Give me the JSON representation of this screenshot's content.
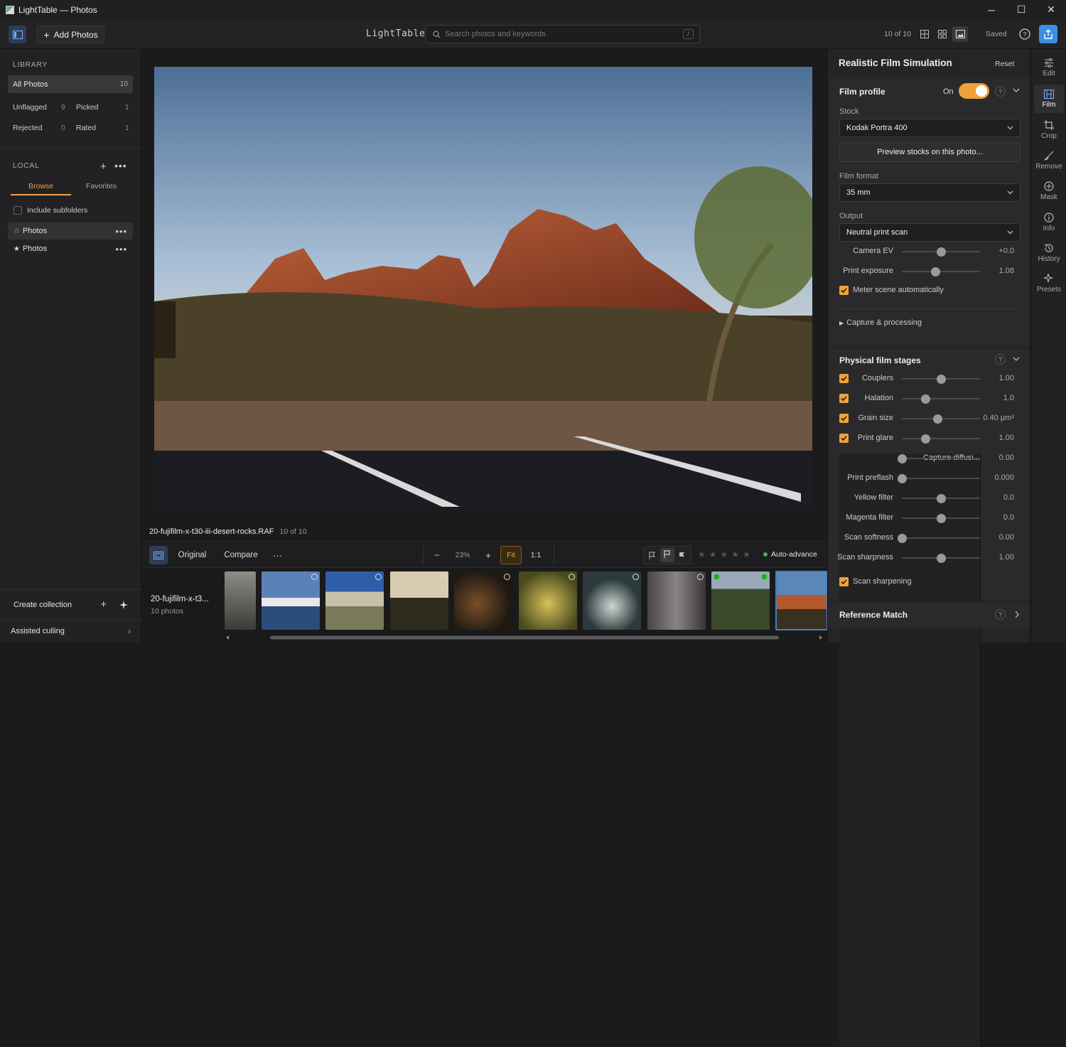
{
  "window": {
    "title": "LightTable — Photos",
    "minimize": "─",
    "maximize": "☐",
    "close": "✕"
  },
  "toolbar": {
    "add_photos": "Add Photos",
    "brand": "LightTable",
    "search_placeholder": "Search photos and keywords",
    "search_key": "/",
    "count": "10 of 10",
    "status": "Saved"
  },
  "sidebar": {
    "library_title": "LIBRARY",
    "all_photos": {
      "label": "All Photos",
      "count": "10"
    },
    "stats": [
      {
        "label": "Unflagged",
        "count": "9"
      },
      {
        "label": "Picked",
        "count": "1"
      },
      {
        "label": "Rejected",
        "count": "0"
      },
      {
        "label": "Rated",
        "count": "1"
      }
    ],
    "local_title": "LOCAL",
    "tabs": [
      "Browse",
      "Favorites"
    ],
    "include_subfolders": "Include subfolders",
    "folders": [
      {
        "star": "☆",
        "label": "Photos"
      },
      {
        "star": "★",
        "label": "Photos"
      }
    ],
    "create_collection": "Create collection",
    "assisted_culling": "Assisted culling"
  },
  "main": {
    "filename": "20-fujifilm-x-t30-iii-desert-rocks.RAF",
    "position": "10 of 10",
    "controls": {
      "original": "Original",
      "compare": "Compare",
      "more": "···",
      "zoom_out": "–",
      "zoom": "23%",
      "zoom_in": "+",
      "fit": "Fit",
      "one_to_one": "1:1",
      "auto_advance": "Auto-advance"
    },
    "album": {
      "name": "20-fujifilm-x-t3...",
      "count": "10 photos"
    }
  },
  "panel": {
    "title": "Realistic Film Simulation",
    "reset": "Reset",
    "film_profile": {
      "title": "Film profile",
      "on_label": "On",
      "enabled": true,
      "stock_label": "Stock",
      "stock": "Kodak Portra 400",
      "preview_btn": "Preview stocks on this photo...",
      "format_label": "Film format",
      "format": "35 mm",
      "output_label": "Output",
      "output": "Neutral print scan",
      "sliders": [
        {
          "label": "Camera EV",
          "value": "+0.0",
          "level": 0.5
        },
        {
          "label": "Print exposure",
          "value": "1.08",
          "level": 0.43
        }
      ],
      "meter": "Meter scene automatically",
      "capture": "Capture & processing"
    },
    "stages": {
      "title": "Physical film stages",
      "rows": [
        {
          "check": true,
          "label": "Couplers",
          "value": "1.00",
          "level": 0.5
        },
        {
          "check": true,
          "label": "Halation",
          "value": "1.0",
          "level": 0.3
        },
        {
          "check": true,
          "label": "Grain size",
          "value": "0.40 µm²",
          "level": 0.45
        },
        {
          "check": true,
          "label": "Print glare",
          "value": "1.00",
          "level": 0.3
        },
        {
          "check": false,
          "label": "Capture diffusi...",
          "value": "0.00",
          "level": 0.0
        },
        {
          "check": false,
          "label": "Print preflash",
          "value": "0.000",
          "level": 0.0
        },
        {
          "check": false,
          "label": "Yellow filter",
          "value": "0.0",
          "level": 0.5
        },
        {
          "check": false,
          "label": "Magenta filter",
          "value": "0.0",
          "level": 0.5
        },
        {
          "check": false,
          "label": "Scan softness",
          "value": "0.00",
          "level": 0.0
        },
        {
          "check": false,
          "label": "Scan sharpness",
          "value": "1.00",
          "level": 0.5
        }
      ],
      "scan_sharpening": "Scan sharpening"
    },
    "reference_match": "Reference Match"
  },
  "rail": [
    "Edit",
    "Film",
    "Crop",
    "Remove",
    "Mask",
    "Info",
    "History",
    "Presets"
  ],
  "colors": {
    "accent": "#f0a13a",
    "share": "#3a8ee6",
    "selected": "#3b82c4"
  }
}
